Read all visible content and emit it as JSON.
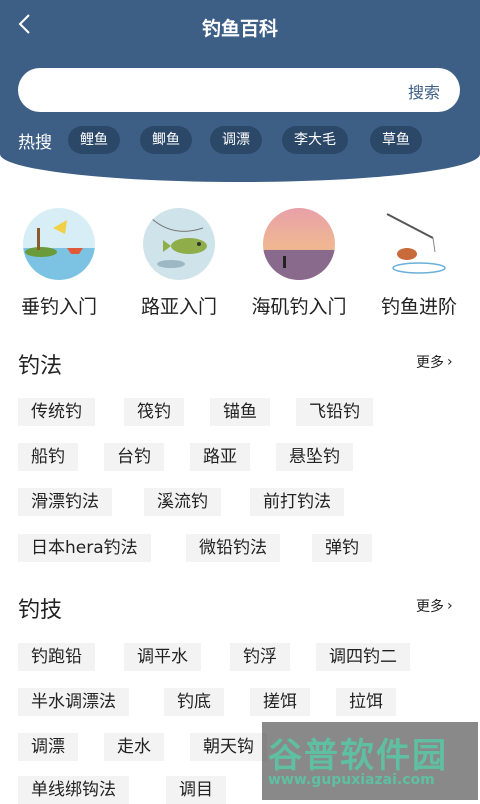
{
  "header": {
    "title": "钓鱼百科",
    "back_icon": "chevron-left-icon"
  },
  "search": {
    "value": "",
    "button": "搜索"
  },
  "hot": {
    "label": "热搜",
    "tags": [
      "鲤鱼",
      "鲫鱼",
      "调漂",
      "李大毛",
      "草鱼"
    ]
  },
  "categories": [
    {
      "label": "垂钓入门",
      "icon": "fishing-boat-illustration"
    },
    {
      "label": "路亚入门",
      "icon": "lure-fish-illustration"
    },
    {
      "label": "海矶钓入门",
      "icon": "sunset-sea-photo"
    },
    {
      "label": "钓鱼进阶",
      "icon": "fish-jumping-illustration"
    }
  ],
  "sections": [
    {
      "title": "钓法",
      "more": "更多",
      "items": [
        "传统钓",
        "筏钓",
        "锚鱼",
        "飞铅钓",
        "船钓",
        "台钓",
        "路亚",
        "悬坠钓",
        "滑漂钓法",
        "溪流钓",
        "前打钓法",
        "日本hera钓法",
        "微铅钓法",
        "弹钓"
      ]
    },
    {
      "title": "钓技",
      "more": "更多",
      "items": [
        "钓跑铅",
        "调平水",
        "钓浮",
        "调四钓二",
        "半水调漂法",
        "钓底",
        "搓饵",
        "拉饵",
        "调漂",
        "走水",
        "朝天钩",
        "单线绑钩法",
        "调目"
      ]
    }
  ],
  "watermark": {
    "text": "谷普软件园",
    "url": "www.gupuxiazai.com"
  },
  "colors": {
    "header": "#3d5f86",
    "chip_bg": "#f3f3f3",
    "hot_tag_bg": "#2c4868"
  }
}
